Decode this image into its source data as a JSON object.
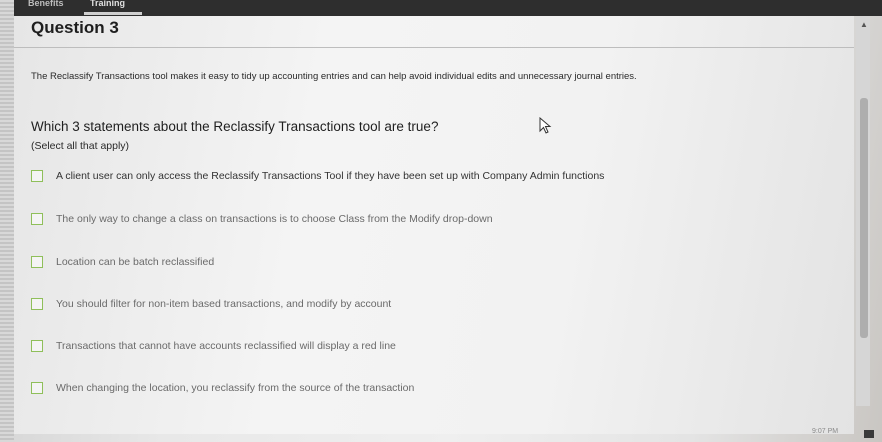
{
  "nav": {
    "tabs": [
      "Benefits",
      "Training"
    ],
    "active_tab": "Training"
  },
  "question": {
    "title": "Question 3",
    "intro": "The Reclassify Transactions tool makes it easy to tidy up accounting entries and can help avoid individual edits and unnecessary journal entries.",
    "prompt": "Which 3 statements about the Reclassify Transactions tool are true?",
    "hint": "(Select all that apply)"
  },
  "options": [
    "A client user can only access the Reclassify Transactions Tool if they have been set up with Company Admin functions",
    "The only way to change a class on transactions is to choose Class from the Modify drop-down",
    "Location can be batch reclassified",
    "You should filter for non-item based transactions, and modify by account",
    "Transactions that cannot have accounts reclassified will display a red line",
    "When changing the location, you reclassify from the source of the transaction"
  ],
  "taskbar": {
    "time": "9:07 PM"
  },
  "colors": {
    "checkbox_border": "#8fbf5a",
    "nav_bg": "#2e2e2e"
  }
}
